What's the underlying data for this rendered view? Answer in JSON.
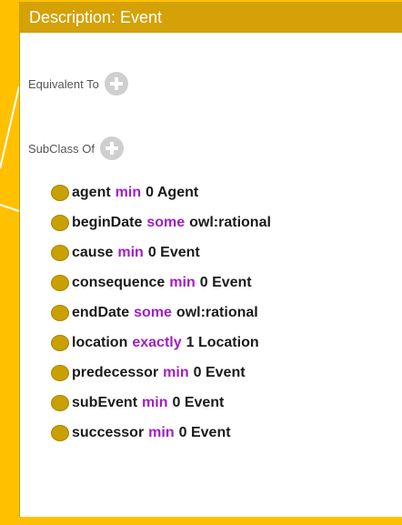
{
  "header": {
    "title": "Description: Event"
  },
  "equivalent_to": {
    "label": "Equivalent To"
  },
  "subclass_of": {
    "label": "SubClass Of",
    "axioms": [
      {
        "property": "agent",
        "restriction": "min",
        "value": "0 Agent"
      },
      {
        "property": "beginDate",
        "restriction": "some",
        "value": "owl:rational"
      },
      {
        "property": "cause",
        "restriction": "min",
        "value": "0 Event"
      },
      {
        "property": "consequence",
        "restriction": "min",
        "value": "0 Event"
      },
      {
        "property": "endDate",
        "restriction": "some",
        "value": "owl:rational"
      },
      {
        "property": "location",
        "restriction": "exactly",
        "value": "1 Location"
      },
      {
        "property": "predecessor",
        "restriction": "min",
        "value": "0 Event"
      },
      {
        "property": "subEvent",
        "restriction": "min",
        "value": "0 Event"
      },
      {
        "property": "successor",
        "restriction": "min",
        "value": "0 Event"
      }
    ]
  },
  "colors": {
    "background": "#FFC000",
    "header": "#D4A107",
    "keyword": "#A020C0",
    "bullet": "#C9A000"
  },
  "icons": [
    "add-icon",
    "class-bullet-icon"
  ]
}
